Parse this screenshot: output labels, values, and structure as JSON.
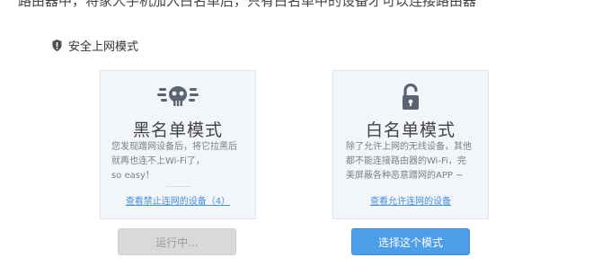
{
  "top_cut_text": "路由器中，将家人手机加入白名单后，只有白名单中的设备才可以连接路由器",
  "section": {
    "title": "安全上网模式"
  },
  "blacklist": {
    "title": "黑名单模式",
    "desc_lines": [
      "您发现蹭网设备后，将它拉黑后",
      "就再也连不上Wi-Fi了，",
      "so easy！"
    ],
    "link": "查看禁止连网的设备（4）",
    "button": "运行中..."
  },
  "whitelist": {
    "title": "白名单模式",
    "desc_lines": [
      "除了允许上网的无线设备，其他",
      "都不能连接路由器的Wi-Fi，完",
      "美屏蔽各种恶意蹭网的APP ~"
    ],
    "link": "查看允许连网的设备",
    "button": "选择这个模式"
  },
  "colors": {
    "card_bg": "#f2f5f9",
    "link": "#4a8fd6",
    "primary_button": "#4d9de8",
    "disabled_button": "#d9d9d9",
    "icon": "#5b6470"
  }
}
